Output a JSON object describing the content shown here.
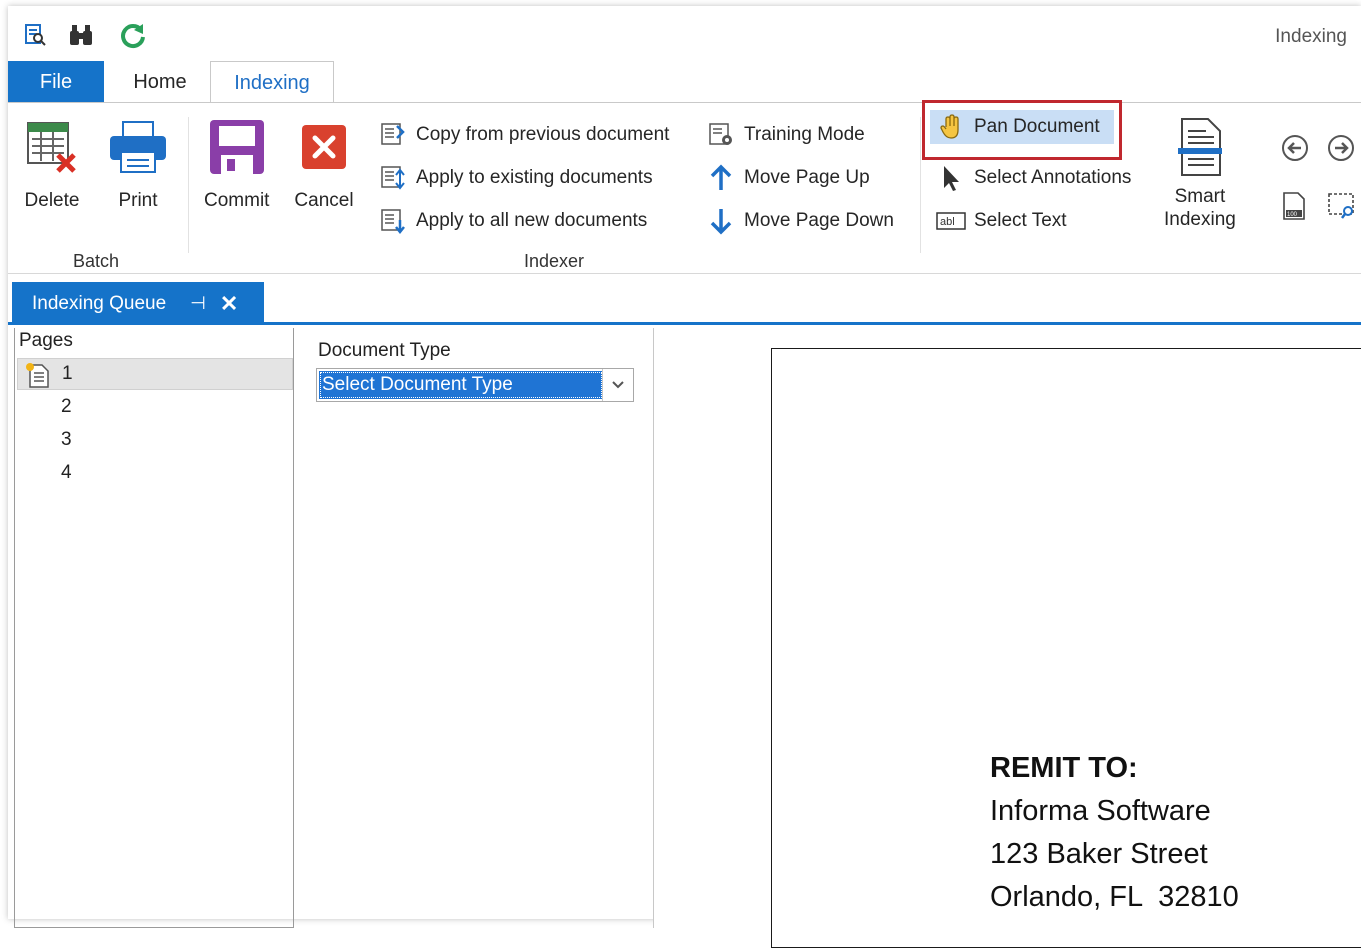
{
  "window": {
    "title": "Indexing"
  },
  "quick_access": [
    {
      "icon": "document-search-icon"
    },
    {
      "icon": "binoculars-icon"
    },
    {
      "icon": "refresh-icon"
    }
  ],
  "tabs": {
    "file": "File",
    "home": "Home",
    "indexing": "Indexing"
  },
  "ribbon": {
    "batch": {
      "label": "Batch",
      "delete": "Delete",
      "print": "Print"
    },
    "indexer": {
      "label": "Indexer",
      "commit": "Commit",
      "cancel": "Cancel",
      "copy_previous": "Copy from previous document",
      "apply_existing": "Apply to existing documents",
      "apply_new": "Apply to all new documents",
      "training_mode": "Training Mode",
      "move_up": "Move Page Up",
      "move_down": "Move Page Down"
    },
    "tools": {
      "pan": "Pan Document",
      "select_annotations": "Select Annotations",
      "select_text": "Select Text",
      "smart_line1": "Smart",
      "smart_line2": "Indexing"
    },
    "colors": {
      "accent": "#1573c9",
      "highlight_border": "#c0282e",
      "pan_bg": "#c9def5"
    }
  },
  "doc_tab": {
    "label": "Indexing Queue"
  },
  "pages_panel": {
    "header": "Pages",
    "pages": [
      "1",
      "2",
      "3",
      "4"
    ],
    "selected": "1"
  },
  "fields_panel": {
    "doctype_label": "Document Type",
    "doctype_value": "Select Document Type"
  },
  "document": {
    "remit_heading": "REMIT TO:",
    "line1": "Informa Software",
    "line2": "123 Baker Street",
    "line3": "Orlando, FL  32810"
  }
}
